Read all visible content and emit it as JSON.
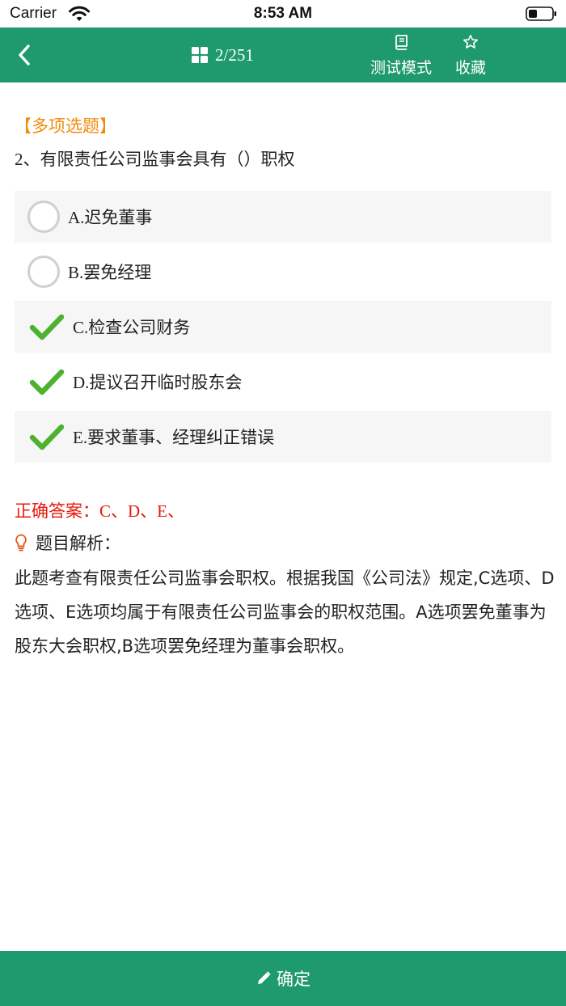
{
  "status_bar": {
    "carrier": "Carrier",
    "time": "8:53 AM"
  },
  "nav": {
    "progress": "2/251",
    "mode_label": "测试模式",
    "favorite_label": "收藏",
    "color": "#1f9a6e"
  },
  "question": {
    "type_label": "【多项选题】",
    "number": "2",
    "text": "、有限责任公司监事会具有（）职权",
    "options": [
      {
        "letter": "A.",
        "text": "迟免董事",
        "checked": false
      },
      {
        "letter": "B.",
        "text": "罢免经理",
        "checked": false
      },
      {
        "letter": "C.",
        "text": "检查公司财务",
        "checked": true
      },
      {
        "letter": "D.",
        "text": "提议召开临时股东会",
        "checked": true
      },
      {
        "letter": "E.",
        "text": "要求董事、经理纠正错误",
        "checked": true
      }
    ]
  },
  "answer": {
    "label": "正确答案：",
    "value": "C、D、E、"
  },
  "analysis": {
    "title": "题目解析：",
    "body": "此题考查有限责任公司监事会职权。根据我国《公司法》规定,C选项、D选项、E选项均属于有限责任公司监事会的职权范围。A选项罢免董事为股东大会职权,B选项罢免经理为董事会职权。"
  },
  "footer": {
    "confirm_label": "确定"
  },
  "icons": {
    "back": "chevron-left-icon",
    "grid": "grid-icon",
    "book": "book-icon",
    "star": "star-outline-icon",
    "check": "check-icon",
    "radio": "radio-empty-icon",
    "bulb": "lightbulb-icon",
    "pencil": "pencil-icon"
  },
  "colors": {
    "accent": "#1f9a6e",
    "type_label": "#f28a0c",
    "answer": "#e8180c",
    "check": "#4cb22f"
  }
}
